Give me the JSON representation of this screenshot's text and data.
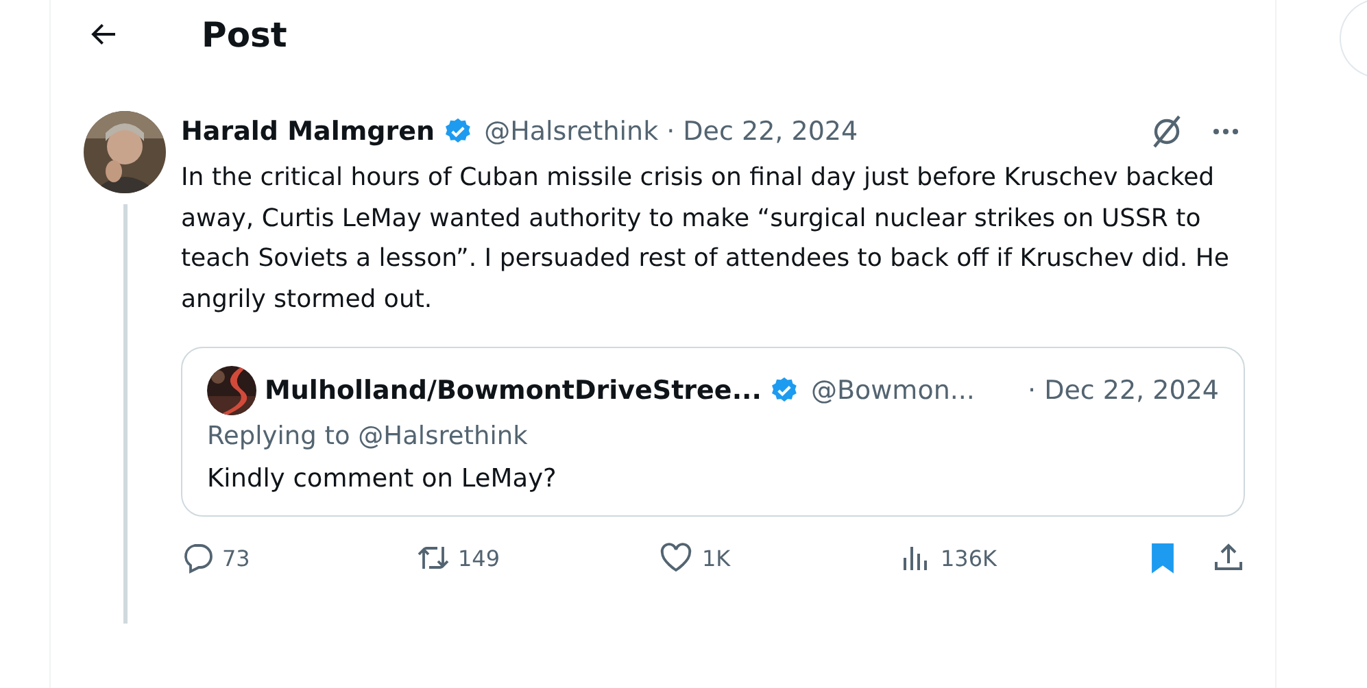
{
  "header": {
    "title": "Post"
  },
  "post": {
    "author": "Harald Malmgren",
    "verified": true,
    "handle": "@Halsrethink",
    "date": "· Dec 22, 2024",
    "text": "In the critical hours of Cuban missile crisis on final day just before Kruschev backed away, Curtis LeMay wanted authority to make “surgical nuclear strikes on USSR to teach Soviets a lesson”. I persuaded rest of attendees to back off if Kruschev did. He angrily stormed out.",
    "quote": {
      "author": "Mulholland/BowmontDriveStree...",
      "verified": true,
      "handle": "@Bowmon...",
      "date": "· Dec 22, 2024",
      "replying_to": "Replying to @Halsrethink",
      "text": "Kindly comment on LeMay?"
    },
    "actions": [
      {
        "kind": "reply",
        "count": "73"
      },
      {
        "kind": "repost",
        "count": "149"
      },
      {
        "kind": "like",
        "count": "1K"
      },
      {
        "kind": "views",
        "count": "136K"
      }
    ],
    "bookmarked": true
  }
}
